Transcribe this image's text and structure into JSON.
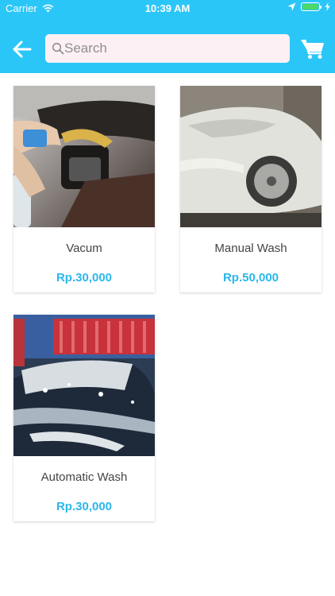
{
  "status_bar": {
    "carrier": "Carrier",
    "time": "10:39 AM"
  },
  "header": {
    "back_icon": "arrow-left-icon",
    "search": {
      "placeholder": "Search",
      "value": ""
    },
    "cart_icon": "cart-icon"
  },
  "colors": {
    "accent": "#2bc6f8",
    "price": "#2bb7ea",
    "search_bg": "#fdf0f4"
  },
  "products": [
    {
      "title": "Vacum",
      "price": "Rp.30,000",
      "image": "car-interior-cleaning-photo"
    },
    {
      "title": "Manual Wash",
      "price": "Rp.50,000",
      "image": "foam-covered-car-photo"
    },
    {
      "title": "Automatic Wash",
      "price": "Rp.30,000",
      "image": "automatic-car-wash-photo"
    }
  ]
}
